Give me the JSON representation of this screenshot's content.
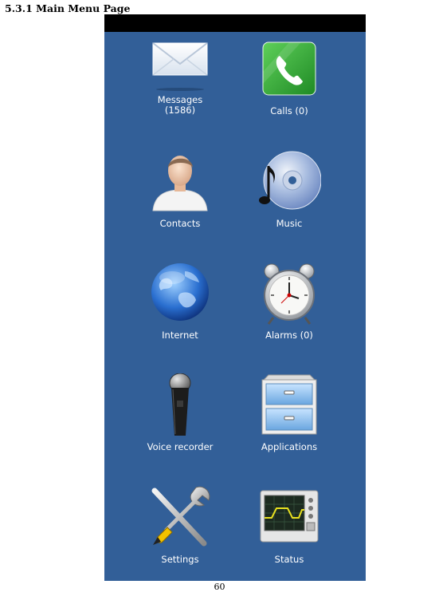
{
  "document": {
    "section_heading": "5.3.1 Main Menu Page",
    "page_number": "60"
  },
  "colors": {
    "screen_background": "#325f98",
    "status_bar": "#000000",
    "label_text": "#ffffff"
  },
  "menu": {
    "items": [
      {
        "label": "Messages\n(1586)",
        "icon": "envelope-icon"
      },
      {
        "label": "Calls (0)",
        "icon": "phone-icon"
      },
      {
        "label": "Contacts",
        "icon": "person-icon"
      },
      {
        "label": "Music",
        "icon": "music-cd-icon"
      },
      {
        "label": "Internet",
        "icon": "globe-icon"
      },
      {
        "label": "Alarms (0)",
        "icon": "alarm-clock-icon"
      },
      {
        "label": "Voice recorder",
        "icon": "microphone-icon"
      },
      {
        "label": "Applications",
        "icon": "cabinet-icon"
      },
      {
        "label": "Settings",
        "icon": "tools-icon"
      },
      {
        "label": "Status",
        "icon": "monitor-icon"
      }
    ]
  }
}
